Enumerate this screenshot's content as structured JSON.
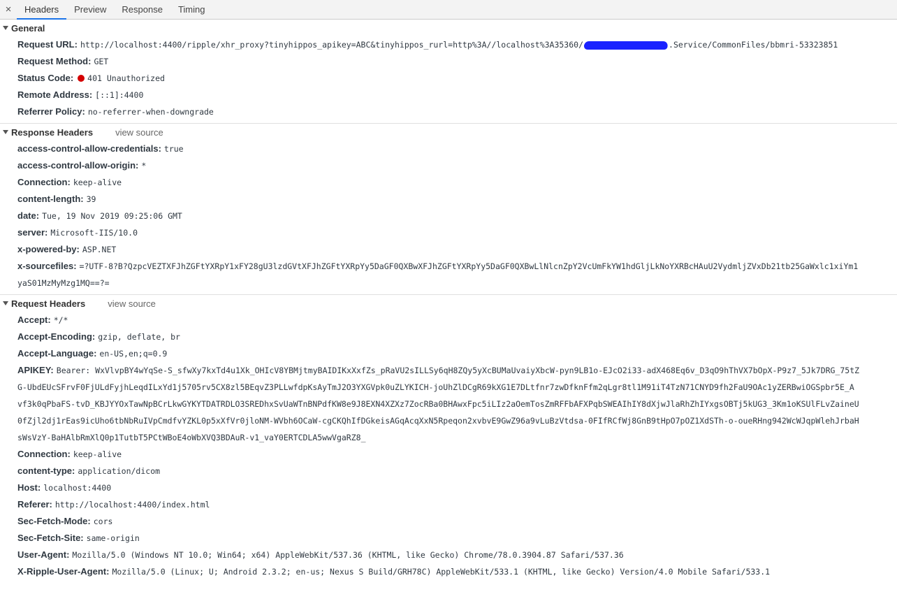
{
  "tabs": {
    "close": "×",
    "items": [
      "Headers",
      "Preview",
      "Response",
      "Timing"
    ]
  },
  "general": {
    "title": "General",
    "request_url_label": "Request URL:",
    "request_url_value": "http://localhost:4400/ripple/xhr_proxy?tinyhippos_apikey=ABC&tinyhippos_rurl=http%3A//localhost%3A35360/",
    "request_url_suffix": ".Service/CommonFiles/bbmri-53323851",
    "request_method_label": "Request Method:",
    "request_method_value": "GET",
    "status_code_label": "Status Code:",
    "status_code_value": "401 Unauthorized",
    "status_color": "#d40000",
    "remote_address_label": "Remote Address:",
    "remote_address_value": "[::1]:4400",
    "referrer_policy_label": "Referrer Policy:",
    "referrer_policy_value": "no-referrer-when-downgrade"
  },
  "response_headers": {
    "title": "Response Headers",
    "view_source": "view source",
    "items": [
      {
        "key": "access-control-allow-credentials:",
        "value": "true"
      },
      {
        "key": "access-control-allow-origin:",
        "value": "*"
      },
      {
        "key": "Connection:",
        "value": "keep-alive"
      },
      {
        "key": "content-length:",
        "value": "39"
      },
      {
        "key": "date:",
        "value": "Tue, 19 Nov 2019 09:25:06 GMT"
      },
      {
        "key": "server:",
        "value": "Microsoft-IIS/10.0"
      },
      {
        "key": "x-powered-by:",
        "value": "ASP.NET"
      },
      {
        "key": "x-sourcefiles:",
        "value": "=?UTF-8?B?QzpcVEZTXFJhZGFtYXRpY1xFY28gU3lzdGVtXFJhZGFtYXRpYy5DaGF0QXBwXFJhZGFtYXRpYy5DaGF0QXBwLlNlcnZpY2VcUmFkYW1hdGljLkNoYXRBcHAuU2VydmljZVxDb21tb25GaWxlc1xiYm1"
      }
    ],
    "sourcefiles_cont": "yaS01MzMyMzg1MQ==?="
  },
  "request_headers": {
    "title": "Request Headers",
    "view_source": "view source",
    "accept_label": "Accept:",
    "accept_value": "*/*",
    "accept_encoding_label": "Accept-Encoding:",
    "accept_encoding_value": "gzip, deflate, br",
    "accept_language_label": "Accept-Language:",
    "accept_language_value": "en-US,en;q=0.9",
    "apikey_label": "APIKEY:",
    "apikey_lines": [
      "Bearer: WxVlvpBY4wYqSe-S_sfwXy7kxTd4u1Xk_OHIcV8YBMjtmyBAIDIKxXxfZs_pRaVU2sILLSy6qH8ZQy5yXcBUMaUvaiyXbcW-pyn9LB1o-EJcO2i33-adX468Eq6v_D3qO9hThVX7bOpX-P9z7_5Jk7DRG_75tZ",
      "G-UbdEUcSFrvF0FjULdFyjhLeqdILxYd1j5705rv5CX8zl5BEqvZ3PLLwfdpKsAyTmJ2O3YXGVpk0uZLYKICH-joUhZlDCgR69kXG1E7DLtfnr7zwDfknFfm2qLgr8tl1M91iT4TzN71CNYD9fh2FaU9OAc1yZERBwiOGSpbr5E_A",
      "vf3k0qPbaFS-tvD_KBJYYOxTawNpBCrLkwGYKYTDATRDLO3SREDhxSvUaWTnBNPdfKW8e9J8EXN4XZXz7ZocRBa0BHAwxFpc5iLIz2aOemTosZmRFFbAFXPqbSWEAIhIY8dXjwJlaRhZhIYxgsOBTj5kUG3_3Km1oKSUlFLvZaineU",
      "0fZjl2dj1rEas9icUho6tbNbRuIVpCmdfvYZKL0p5xXfVr0jloNM-WVbh6OCaW-cgCKQhIfDGkeisAGqAcqXxN5Rpeqon2xvbvE9GwZ96a9vLuBzVtdsa-0FIfRCfWj8GnB9tHpO7pOZ1XdSTh-o-oueRHng942WcWJqpWlehJrbaH",
      "sWsVzY-BaHAlbRmXlQ0p1TutbT5PCtWBoE4oWbXVQ3BDAuR-v1_vaY0ERTCDLA5wwVgaRZ8_"
    ],
    "connection_label": "Connection:",
    "connection_value": "keep-alive",
    "content_type_label": "content-type:",
    "content_type_value": "application/dicom",
    "host_label": "Host:",
    "host_value": "localhost:4400",
    "referer_label": "Referer:",
    "referer_value": "http://localhost:4400/index.html",
    "sec_fetch_mode_label": "Sec-Fetch-Mode:",
    "sec_fetch_mode_value": "cors",
    "sec_fetch_site_label": "Sec-Fetch-Site:",
    "sec_fetch_site_value": "same-origin",
    "user_agent_label": "User-Agent:",
    "user_agent_value": "Mozilla/5.0 (Windows NT 10.0; Win64; x64) AppleWebKit/537.36 (KHTML, like Gecko) Chrome/78.0.3904.87 Safari/537.36",
    "x_ripple_label": "X-Ripple-User-Agent:",
    "x_ripple_value": "Mozilla/5.0 (Linux; U; Android 2.3.2; en-us; Nexus S Build/GRH78C) AppleWebKit/533.1 (KHTML, like Gecko) Version/4.0 Mobile Safari/533.1"
  }
}
